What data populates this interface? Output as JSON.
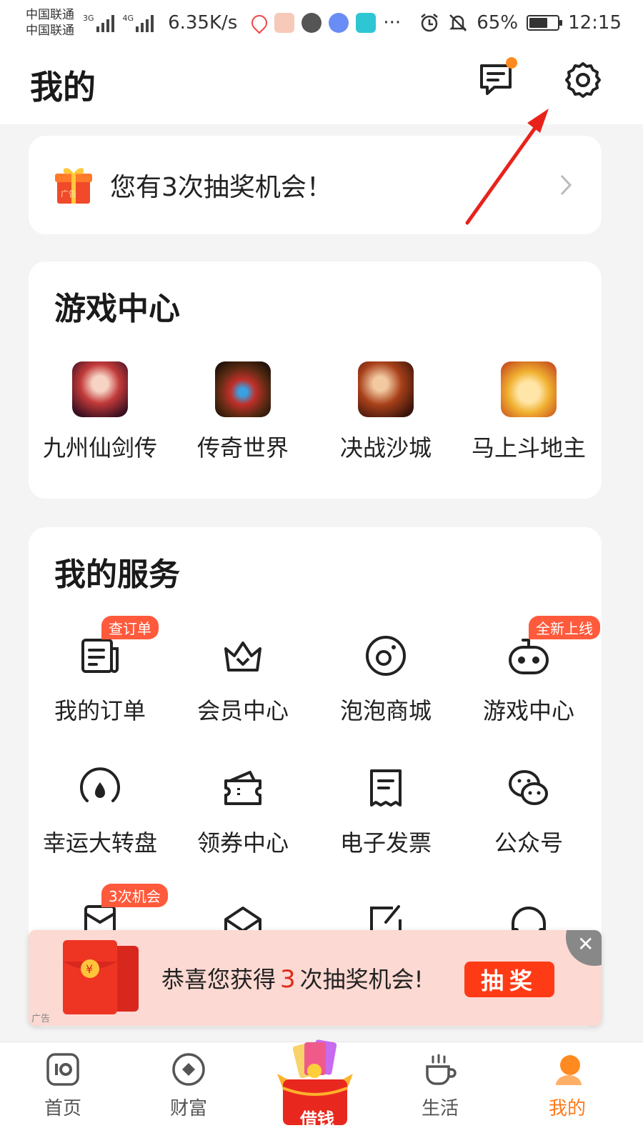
{
  "status_bar": {
    "carrier1": "中国联通",
    "carrier2": "中国联通",
    "net1": "3G",
    "net2": "4G",
    "speed": "6.35K/s",
    "more": "···",
    "battery": "65%",
    "battery_level": 0.65,
    "time": "12:15"
  },
  "header": {
    "title": "我的"
  },
  "lottery": {
    "text": "您有3次抽奖机会！"
  },
  "games": {
    "title": "游戏中心",
    "items": [
      {
        "label": "九州仙剑传",
        "icon": "game-jiuzhou-icon"
      },
      {
        "label": "传奇世界",
        "icon": "game-chuanqi-icon"
      },
      {
        "label": "决战沙城",
        "icon": "game-juezhan-icon"
      },
      {
        "label": "马上斗地主",
        "icon": "game-doudizhu-icon"
      }
    ]
  },
  "services": {
    "title": "我的服务",
    "row1": [
      {
        "label": "我的订单",
        "badge": "查订单",
        "icon": "order-icon"
      },
      {
        "label": "会员中心",
        "badge": "",
        "icon": "crown-icon"
      },
      {
        "label": "泡泡商城",
        "badge": "",
        "icon": "bubble-mall-icon"
      },
      {
        "label": "游戏中心",
        "badge": "全新上线",
        "icon": "gamepad-icon"
      }
    ],
    "row2": [
      {
        "label": "幸运大转盘",
        "icon": "wheel-icon"
      },
      {
        "label": "领券中心",
        "icon": "coupon-icon"
      },
      {
        "label": "电子发票",
        "icon": "invoice-icon"
      },
      {
        "label": "公众号",
        "icon": "wechat-icon"
      }
    ],
    "row3_badge": "3次机会"
  },
  "promo": {
    "text_before": "恭喜您获得",
    "count": "3",
    "text_after": "次抽奖机会!",
    "button": "抽奖",
    "ad_tag": "广告",
    "gift_tag": "广告"
  },
  "tabs": [
    {
      "label": "首页",
      "icon": "home-icon"
    },
    {
      "label": "财富",
      "icon": "wealth-icon"
    },
    {
      "label": "借钱",
      "icon": "borrow-gift-icon"
    },
    {
      "label": "生活",
      "icon": "coffee-icon"
    },
    {
      "label": "我的",
      "icon": "profile-icon",
      "active": true
    }
  ],
  "colors": {
    "accent": "#ff7a1a",
    "badge": "#ff5a3c",
    "promo_bg": "#fcd9d2",
    "draw_button": "#ff3b16",
    "arrow": "#e8221b"
  }
}
